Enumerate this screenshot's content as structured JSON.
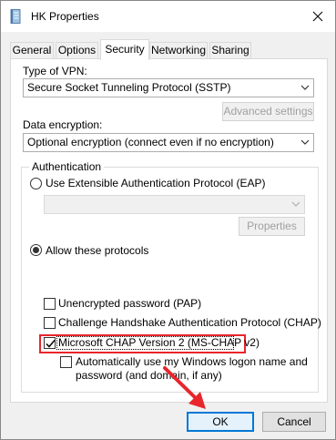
{
  "window": {
    "title": "HK Properties"
  },
  "tabs": [
    {
      "label": "General",
      "active": false
    },
    {
      "label": "Options",
      "active": false
    },
    {
      "label": "Security",
      "active": true
    },
    {
      "label": "Networking",
      "active": false
    },
    {
      "label": "Sharing",
      "active": false
    }
  ],
  "security": {
    "vpn_type_label": "Type of VPN:",
    "vpn_type_value": "Secure Socket Tunneling Protocol (SSTP)",
    "advanced_settings_label": "Advanced settings",
    "data_encryption_label": "Data encryption:",
    "data_encryption_value": "Optional encryption (connect even if no encryption)",
    "authentication_title": "Authentication",
    "eap_radio_label": "Use Extensible Authentication Protocol (EAP)",
    "eap_selected": false,
    "eap_select_value": "",
    "properties_label": "Properties",
    "allow_protocols_label": "Allow these protocols",
    "allow_protocols_selected": true,
    "protocols": [
      {
        "label": "Unencrypted password (PAP)",
        "checked": false
      },
      {
        "label": "Challenge Handshake Authentication Protocol (CHAP)",
        "checked": false
      },
      {
        "label": "Microsoft CHAP Version 2 (MS-CHAP v2)",
        "checked": true
      }
    ],
    "auto_logon_line1": "Automatically use my Windows logon name and",
    "auto_logon_line2": "password (and domain, if any)",
    "auto_logon_checked": false
  },
  "footer": {
    "ok_label": "OK",
    "cancel_label": "Cancel"
  },
  "colors": {
    "highlight": "#e8262b",
    "default_button_border": "#0078d7"
  },
  "icons": {
    "window_icon": "phone-book-icon",
    "close": "close-icon"
  }
}
